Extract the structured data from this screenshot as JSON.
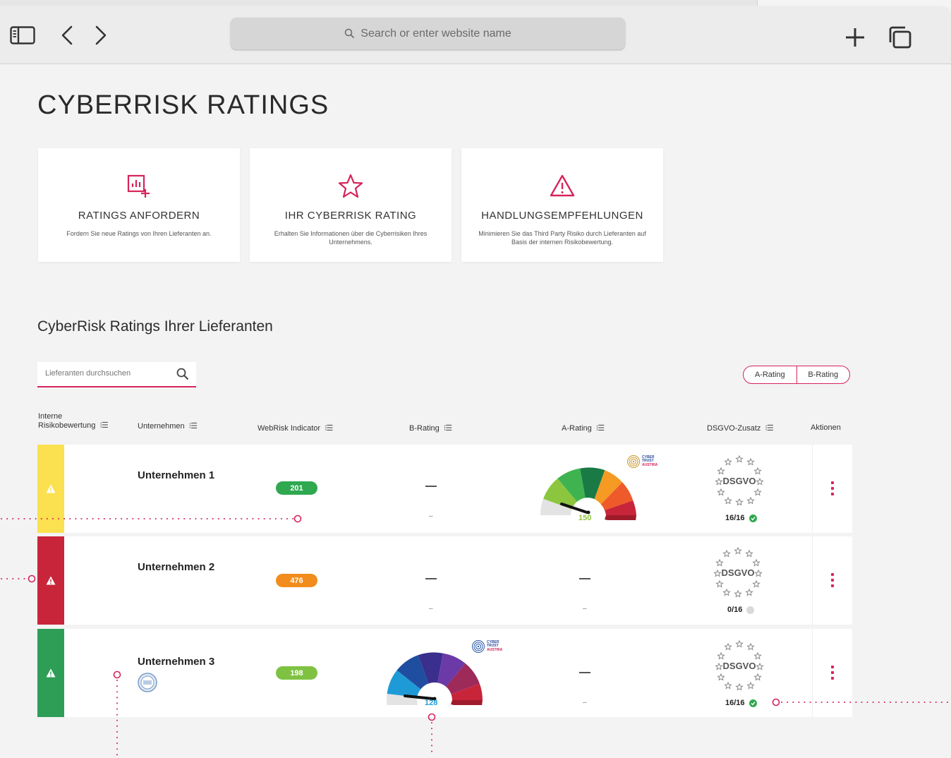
{
  "browser": {
    "address_placeholder": "Search or enter website name"
  },
  "page": {
    "title": "CYBERRISK RATINGS",
    "cards": [
      {
        "title": "RATINGS ANFORDERN",
        "desc": "Fordern Sie neue Ratings von Ihren Lieferanten an."
      },
      {
        "title": "IHR CYBERRISK RATING",
        "desc": "Erhalten Sie Informationen über die Cyberrisiken Ihres Unternehmens."
      },
      {
        "title": "HANDLUNGSEMPFEHLUNGEN",
        "desc": "Minimieren Sie das Third Party Risiko durch Lieferanten auf Basis der internen Risikobewertung."
      }
    ],
    "section_title": "CyberRisk Ratings Ihrer Lieferanten",
    "search_placeholder": "Lieferanten durchsuchen",
    "rating_toggle": [
      "A-Rating",
      "B-Rating"
    ]
  },
  "table": {
    "headers": {
      "interne_line1": "Interne",
      "interne_line2": "Risikobewertung",
      "unternehmen": "Unternehmen",
      "webrisk": "WebRisk Indicator",
      "brating": "B-Rating",
      "arating": "A-Rating",
      "dsgvo": "DSGVO-Zusatz",
      "aktionen": "Aktionen"
    },
    "rows": [
      {
        "company": "Unternehmen 1",
        "webrisk": "201",
        "webrisk_color": "#2fa84f",
        "risk_color": "#fbe04f",
        "b_rating": "–",
        "a_rating_score": "150",
        "dsgvo_label": "DSGVO",
        "dsgvo_count": "16/16",
        "dsgvo_ok": true,
        "gauge_brand": [
          "CYBER",
          "TRUST",
          "AUSTRIA"
        ]
      },
      {
        "company": "Unternehmen 2",
        "webrisk": "476",
        "webrisk_color": "#f28c1c",
        "risk_color": "#c8253a",
        "b_rating": "–",
        "a_rating": "–",
        "dsgvo_label": "DSGVO",
        "dsgvo_count": "0/16",
        "dsgvo_ok": false
      },
      {
        "company": "Unternehmen 3",
        "webrisk": "198",
        "webrisk_color": "#7fc242",
        "risk_color": "#2e9e57",
        "b_rating_score": "128",
        "a_rating": "–",
        "dsgvo_label": "DSGVO",
        "dsgvo_count": "16/16",
        "dsgvo_ok": true,
        "gauge_brand": [
          "CYBER",
          "TRUST",
          "AUSTRIA"
        ]
      }
    ]
  },
  "colors": {
    "accent": "#d6245a",
    "ok": "#2fa84f"
  }
}
